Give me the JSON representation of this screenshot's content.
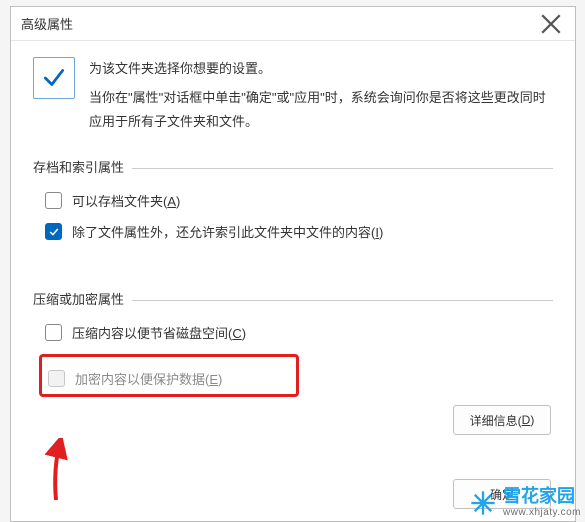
{
  "dialog": {
    "title": "高级属性",
    "intro_line1": "为该文件夹选择你想要的设置。",
    "intro_line2": "当你在\"属性\"对话框中单击\"确定\"或\"应用\"时，系统会询问你是否将这些更改同时应用于所有子文件夹和文件。"
  },
  "group_archive": {
    "title": "存档和索引属性",
    "archive_label": "可以存档文件夹(",
    "archive_accel": "A",
    "archive_label_end": ")",
    "index_label": "除了文件属性外，还允许索引此文件夹中文件的内容(",
    "index_accel": "I",
    "index_label_end": ")",
    "archive_checked": false,
    "index_checked": true
  },
  "group_compress": {
    "title": "压缩或加密属性",
    "compress_label": "压缩内容以便节省磁盘空间(",
    "compress_accel": "C",
    "compress_label_end": ")",
    "encrypt_label": "加密内容以便保护数据(",
    "encrypt_accel": "E",
    "encrypt_label_end": ")",
    "compress_checked": false,
    "encrypt_checked": false
  },
  "buttons": {
    "details": "详细信息(",
    "details_accel": "D",
    "details_end": ")",
    "ok": "确定"
  },
  "watermark": {
    "name": "雪花家园",
    "url": "www.xhjaty.com"
  }
}
